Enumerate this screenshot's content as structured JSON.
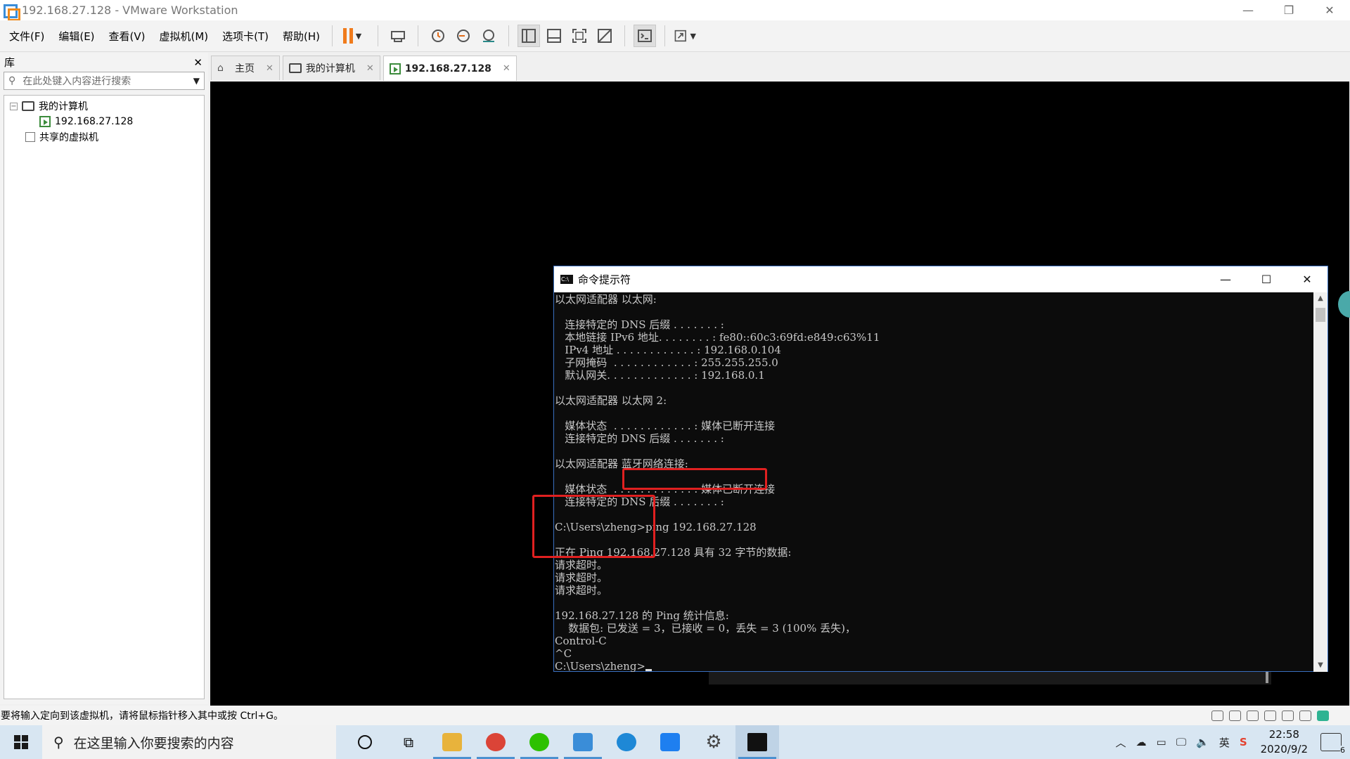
{
  "window": {
    "title": "192.168.27.128 - VMware Workstation",
    "controls": [
      "—",
      "❐",
      "✕"
    ]
  },
  "menu": [
    "文件(F)",
    "编辑(E)",
    "查看(V)",
    "虚拟机(M)",
    "选项卡(T)",
    "帮助(H)"
  ],
  "library": {
    "title": "库",
    "close": "✕",
    "search_placeholder": "在此处键入内容进行搜索",
    "tree": {
      "root": "我的计算机",
      "vm": "192.168.27.128",
      "shared": "共享的虚拟机"
    }
  },
  "tabs": [
    {
      "label": "主页"
    },
    {
      "label": "我的计算机"
    },
    {
      "label": "192.168.27.128"
    }
  ],
  "cmd": {
    "title": "命令提示符",
    "lines": [
      "以太网适配器 以太网:",
      "",
      "   连接特定的 DNS 后缀 . . . . . . . :",
      "   本地链接 IPv6 地址. . . . . . . . : fe80::60c3:69fd:e849:c63%11",
      "   IPv4 地址 . . . . . . . . . . . . : 192.168.0.104",
      "   子网掩码  . . . . . . . . . . . . : 255.255.255.0",
      "   默认网关. . . . . . . . . . . . . : 192.168.0.1",
      "",
      "以太网适配器 以太网 2:",
      "",
      "   媒体状态  . . . . . . . . . . . . : 媒体已断开连接",
      "   连接特定的 DNS 后缀 . . . . . . . :",
      "",
      "以太网适配器 蓝牙网络连接:",
      "",
      "   媒体状态  . . . . . . . . . . . . : 媒体已断开连接",
      "   连接特定的 DNS 后缀 . . . . . . . :",
      "",
      "C:\\Users\\zheng>ping 192.168.27.128",
      "",
      "正在 Ping 192.168.27.128 具有 32 字节的数据:",
      "请求超时。",
      "请求超时。",
      "请求超时。",
      "",
      "192.168.27.128 的 Ping 统计信息:",
      "    数据包: 已发送 = 3，已接收 = 0，丢失 = 3 (100% 丢失)，",
      "Control-C",
      "^C",
      "C:\\Users\\zheng>"
    ]
  },
  "statusbar": {
    "hint": "要将输入定向到该虚拟机，请将鼠标指针移入其中或按 Ctrl+G。"
  },
  "taskbar": {
    "search_placeholder": "在这里输入你要搜索的内容",
    "ime": "英",
    "time": "22:58",
    "date": "2020/9/2",
    "notification_count": "6",
    "app_colors": [
      "#e8b33c",
      "#db4437",
      "#2dc100",
      "#3a8dd8",
      "#1e88d6",
      "#1e7ff0",
      "#444444",
      "#111111"
    ]
  }
}
